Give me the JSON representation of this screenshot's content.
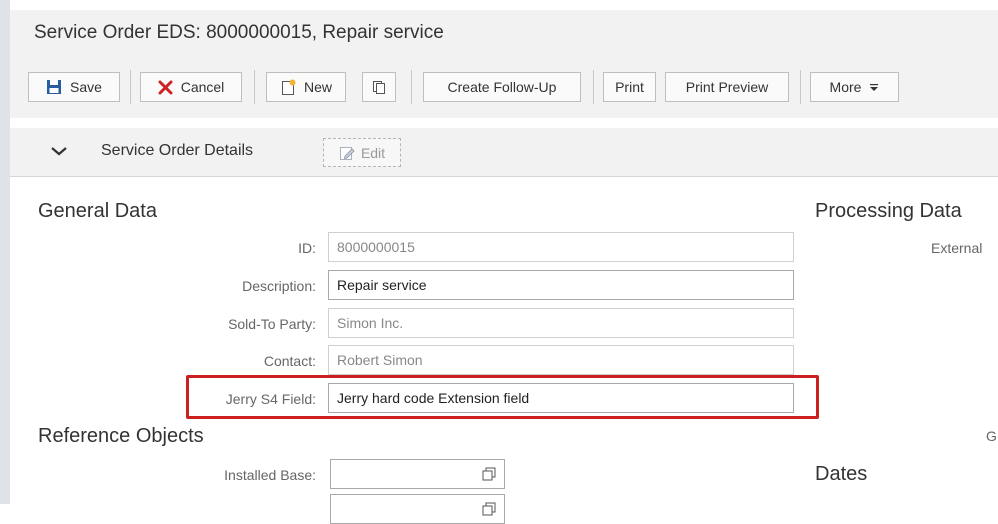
{
  "window_title": "Service Order EDS: 8000000015, Repair service",
  "toolbar": {
    "save_label": "Save",
    "cancel_label": "Cancel",
    "new_label": "New",
    "create_follow_up_label": "Create Follow-Up",
    "print_label": "Print",
    "print_preview_label": "Print Preview",
    "more_label": "More"
  },
  "assignment_block": {
    "title": "Service Order Details",
    "edit_label": "Edit"
  },
  "general_data": {
    "heading": "General Data",
    "fields": [
      {
        "label": "ID:",
        "value": "8000000015"
      },
      {
        "label": "Description:",
        "value": "Repair service"
      },
      {
        "label": "Sold-To Party:",
        "value": "Simon Inc."
      },
      {
        "label": "Contact:",
        "value": "Robert Simon"
      },
      {
        "label": "Jerry S4 Field:",
        "value": "Jerry hard code Extension field"
      }
    ]
  },
  "reference_objects": {
    "heading": "Reference Objects",
    "fields": [
      {
        "label": "Installed Base:",
        "value": ""
      }
    ]
  },
  "processing_data": {
    "heading": "Processing Data",
    "external_label": "External",
    "g_label": "G"
  },
  "dates": {
    "heading": "Dates"
  },
  "colors": {
    "highlight_border": "#cc1f1f",
    "cancel_icon": "#cc2222",
    "save_icon": "#2a5d9f"
  }
}
